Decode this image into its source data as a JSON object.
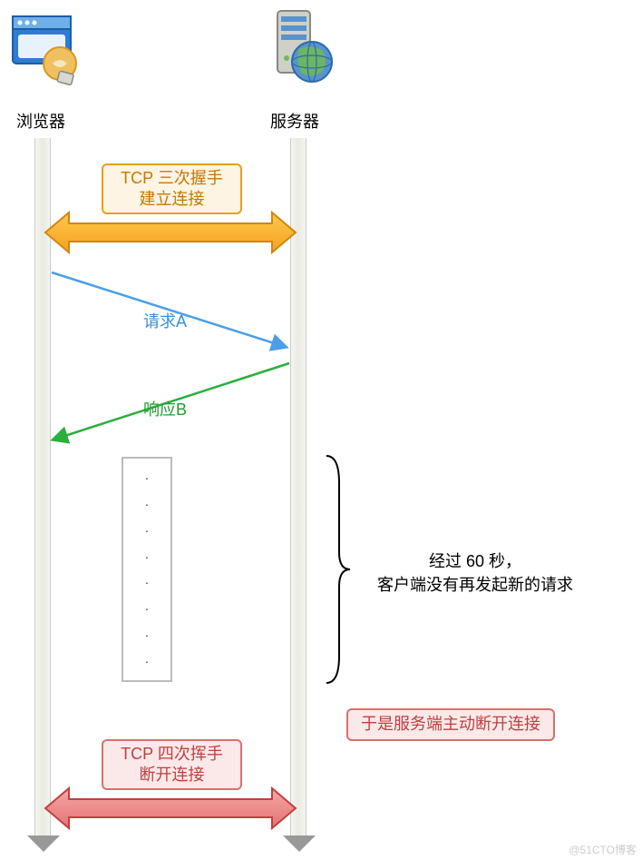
{
  "browser_label": "浏览器",
  "server_label": "服务器",
  "handshake_line1": "TCP 三次握手",
  "handshake_line2": "建立连接",
  "request_label": "请求A",
  "response_label": "响应B",
  "wait_line1": "经过 60 秒，",
  "wait_line2": "客户端没有再发起新的请求",
  "disconnect_note": "于是服务端主动断开连接",
  "teardown_line1": "TCP 四次挥手",
  "teardown_line2": "断开连接",
  "watermark": "@51CTO博客"
}
